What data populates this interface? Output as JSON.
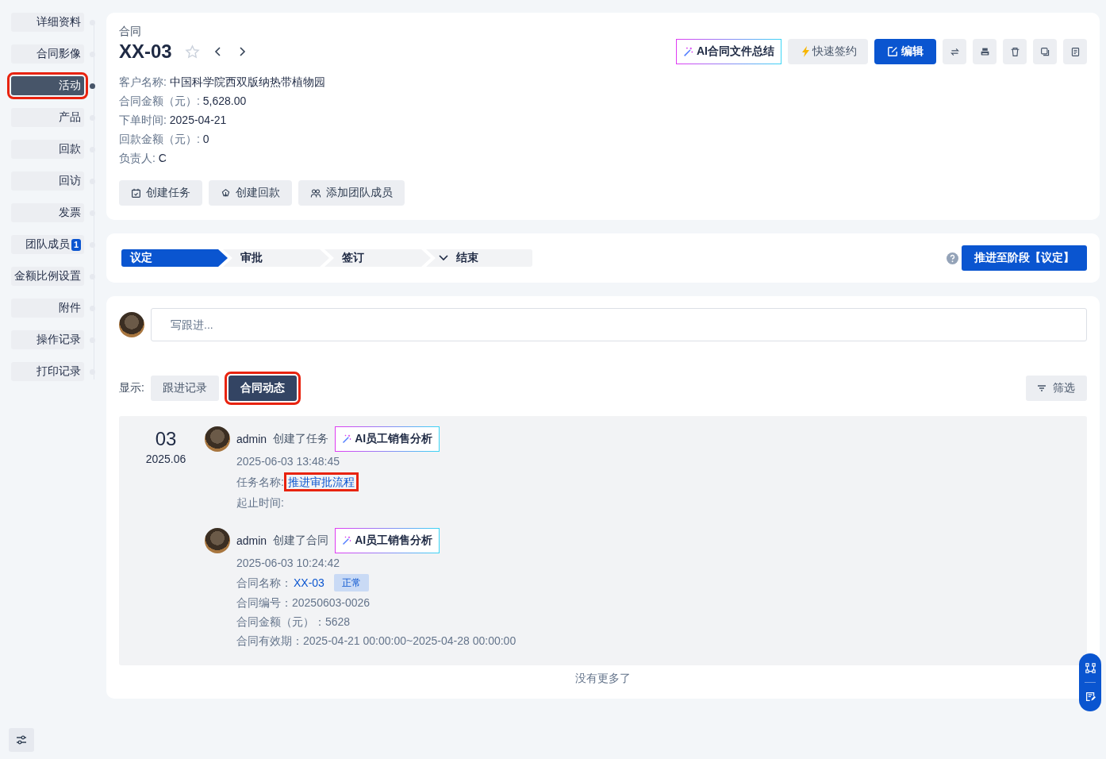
{
  "sidebar": {
    "items": [
      {
        "label": "详细资料",
        "selected": false,
        "highlighted": false
      },
      {
        "label": "合同影像",
        "selected": false,
        "highlighted": false
      },
      {
        "label": "活动",
        "selected": true,
        "highlighted": true
      },
      {
        "label": "产品",
        "selected": false,
        "highlighted": false
      },
      {
        "label": "回款",
        "selected": false,
        "highlighted": false
      },
      {
        "label": "回访",
        "selected": false,
        "highlighted": false
      },
      {
        "label": "发票",
        "selected": false,
        "highlighted": false
      },
      {
        "label": "团队成员",
        "selected": false,
        "highlighted": false,
        "badge": "1"
      },
      {
        "label": "金额比例设置",
        "selected": false,
        "highlighted": false
      },
      {
        "label": "附件",
        "selected": false,
        "highlighted": false
      },
      {
        "label": "操作记录",
        "selected": false,
        "highlighted": false
      },
      {
        "label": "打印记录",
        "selected": false,
        "highlighted": false
      }
    ]
  },
  "header": {
    "breadcrumb": "合同",
    "title": "XX-03",
    "starred": false,
    "buttons": [
      {
        "kind": "ai",
        "label": "AI合同文件总结"
      },
      {
        "kind": "default",
        "label": "快速签约"
      },
      {
        "kind": "primary",
        "label": "编辑"
      }
    ],
    "fields": [
      {
        "label": "客户名称:",
        "value": "中国科学院西双版纳热带植物园"
      },
      {
        "label": "合同金额（元）:",
        "value": "5,628.00"
      },
      {
        "label": "下单时间:",
        "value": "2025-04-21"
      },
      {
        "label": "回款金额（元）:",
        "value": "0"
      },
      {
        "label": "负责人:",
        "value": "C"
      }
    ],
    "actions": [
      "创建任务",
      "创建回款",
      "添加团队成员"
    ]
  },
  "stages": {
    "items": [
      {
        "label": "议定",
        "selected": true,
        "kind": "step"
      },
      {
        "label": "审批",
        "selected": false,
        "kind": "step"
      },
      {
        "label": "签订",
        "selected": false,
        "kind": "step"
      },
      {
        "label": "结束",
        "selected": false,
        "kind": "dropdown"
      }
    ],
    "advance_button": "推进至阶段【议定】"
  },
  "activity": {
    "input": {
      "placeholder": "写跟进..."
    },
    "filter_label": "显示:",
    "tabs": [
      {
        "label": "跟进记录",
        "selected": false,
        "highlighted": false
      },
      {
        "label": "合同动态",
        "selected": true,
        "highlighted": true
      }
    ],
    "filter_button": "筛选",
    "groups": [
      {
        "day": "03",
        "month": "2025.06",
        "entries": [
          {
            "user": "admin",
            "action": "创建了任务",
            "ai_button": "AI员工销售分析",
            "time": "2025-06-03 13:48:45",
            "details": [
              {
                "label": "任务名称:",
                "value": "推进审批流程",
                "kind": "link",
                "highlighted": true
              },
              {
                "label": "起止时间:",
                "kind": "text"
              }
            ]
          },
          {
            "user": "admin",
            "action": "创建了合同",
            "ai_button": "AI员工销售分析",
            "time": "2025-06-03 10:24:42",
            "details": [
              {
                "label": "合同名称：",
                "value": "XX-03",
                "kind": "link",
                "highlighted": false,
                "tag": "正常"
              },
              {
                "label": "合同编号：",
                "value": "20250603-0026",
                "kind": "text"
              },
              {
                "label": "合同金额（元）：",
                "value": "5628",
                "kind": "text"
              },
              {
                "label": "合同有效期：",
                "value": "2025-04-21 00:00:00~2025-04-28 00:00:00",
                "kind": "text"
              }
            ]
          }
        ]
      }
    ],
    "footer": "没有更多了"
  }
}
